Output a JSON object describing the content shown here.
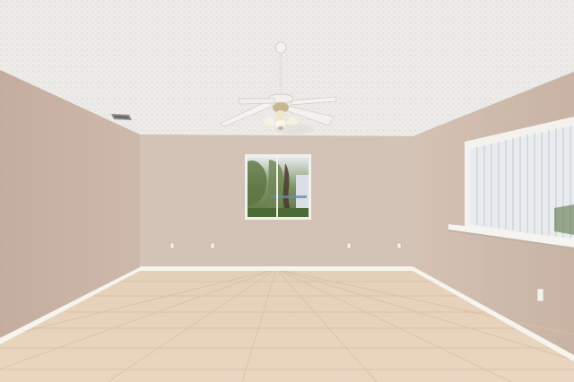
{
  "scene": {
    "description_colors": {
      "ceiling": "#eeeeec",
      "ceiling_shadow": "#d9d7d3",
      "left_wall": "#c9b4a6",
      "back_wall": "#d2c2b5",
      "right_wall": "#d0bdaf",
      "floor": "#e7d3bc",
      "floor_grout": "#d9c2a8",
      "baseboard": "#f6f4ef",
      "window_frame": "#f2f0ec",
      "blinds": "#eef0f2",
      "foliage": "#4e6b3a"
    },
    "icons": [
      "ceiling-fan-icon",
      "air-vent-icon",
      "electrical-outlet-icon"
    ]
  }
}
